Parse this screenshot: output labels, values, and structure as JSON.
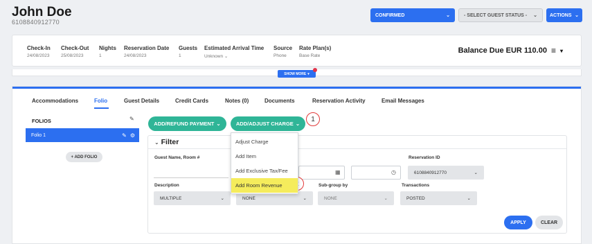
{
  "header": {
    "guest_name": "John Doe",
    "reservation_number": "6108840912770",
    "status_button": "CONFIRMED",
    "guest_status_placeholder": "- SELECT GUEST STATUS -",
    "actions_button": "ACTIONS"
  },
  "info": {
    "checkin": {
      "label": "Check-In",
      "value": "24/08/2023"
    },
    "checkout": {
      "label": "Check-Out",
      "value": "25/08/2023"
    },
    "nights": {
      "label": "Nights",
      "value": "1"
    },
    "reservation_date": {
      "label": "Reservation Date",
      "value": "24/08/2023"
    },
    "guests": {
      "label": "Guests",
      "value": "1"
    },
    "arrival_time": {
      "label": "Estimated Arrival Time",
      "value": "Unknown"
    },
    "source": {
      "label": "Source",
      "value": "Phone"
    },
    "rate_plan": {
      "label": "Rate Plan(s)",
      "value": "Base Rate"
    },
    "balance": "Balance Due EUR 110.00"
  },
  "show_more": "SHOW MORE",
  "tabs": [
    "Accommodations",
    "Folio",
    "Guest Details",
    "Credit Cards",
    "Notes (0)",
    "Documents",
    "Reservation Activity",
    "Email Messages"
  ],
  "folios": {
    "title": "FOLIOS",
    "items": [
      "Folio 1"
    ],
    "add_button": "+ ADD FOLIO"
  },
  "buttons": {
    "refund": "ADD/REFUND PAYMENT",
    "charge": "ADD/ADJUST CHARGE",
    "apply": "APPLY",
    "clear": "CLEAR"
  },
  "callouts": [
    "1",
    "2"
  ],
  "filter": {
    "title": "Filter",
    "guest_label": "Guest Name, Room #",
    "reservation_id_label": "Reservation ID",
    "reservation_id_value": "6108840912770",
    "description_label": "Description",
    "description_value": "MULTIPLE",
    "group_value": "NONE",
    "subgroup_label": "Sub-group by",
    "subgroup_value": "NONE",
    "transactions_label": "Transactions",
    "transactions_value": "POSTED"
  },
  "dropdown": [
    "Adjust Charge",
    "Add Item",
    "Add Exclusive Tax/Fee",
    "Add Room Revenue"
  ],
  "colors": {
    "primary": "#2c6ff0",
    "green": "#2fb597",
    "highlight": "#f5ec5c",
    "callout": "#e23a3a"
  }
}
